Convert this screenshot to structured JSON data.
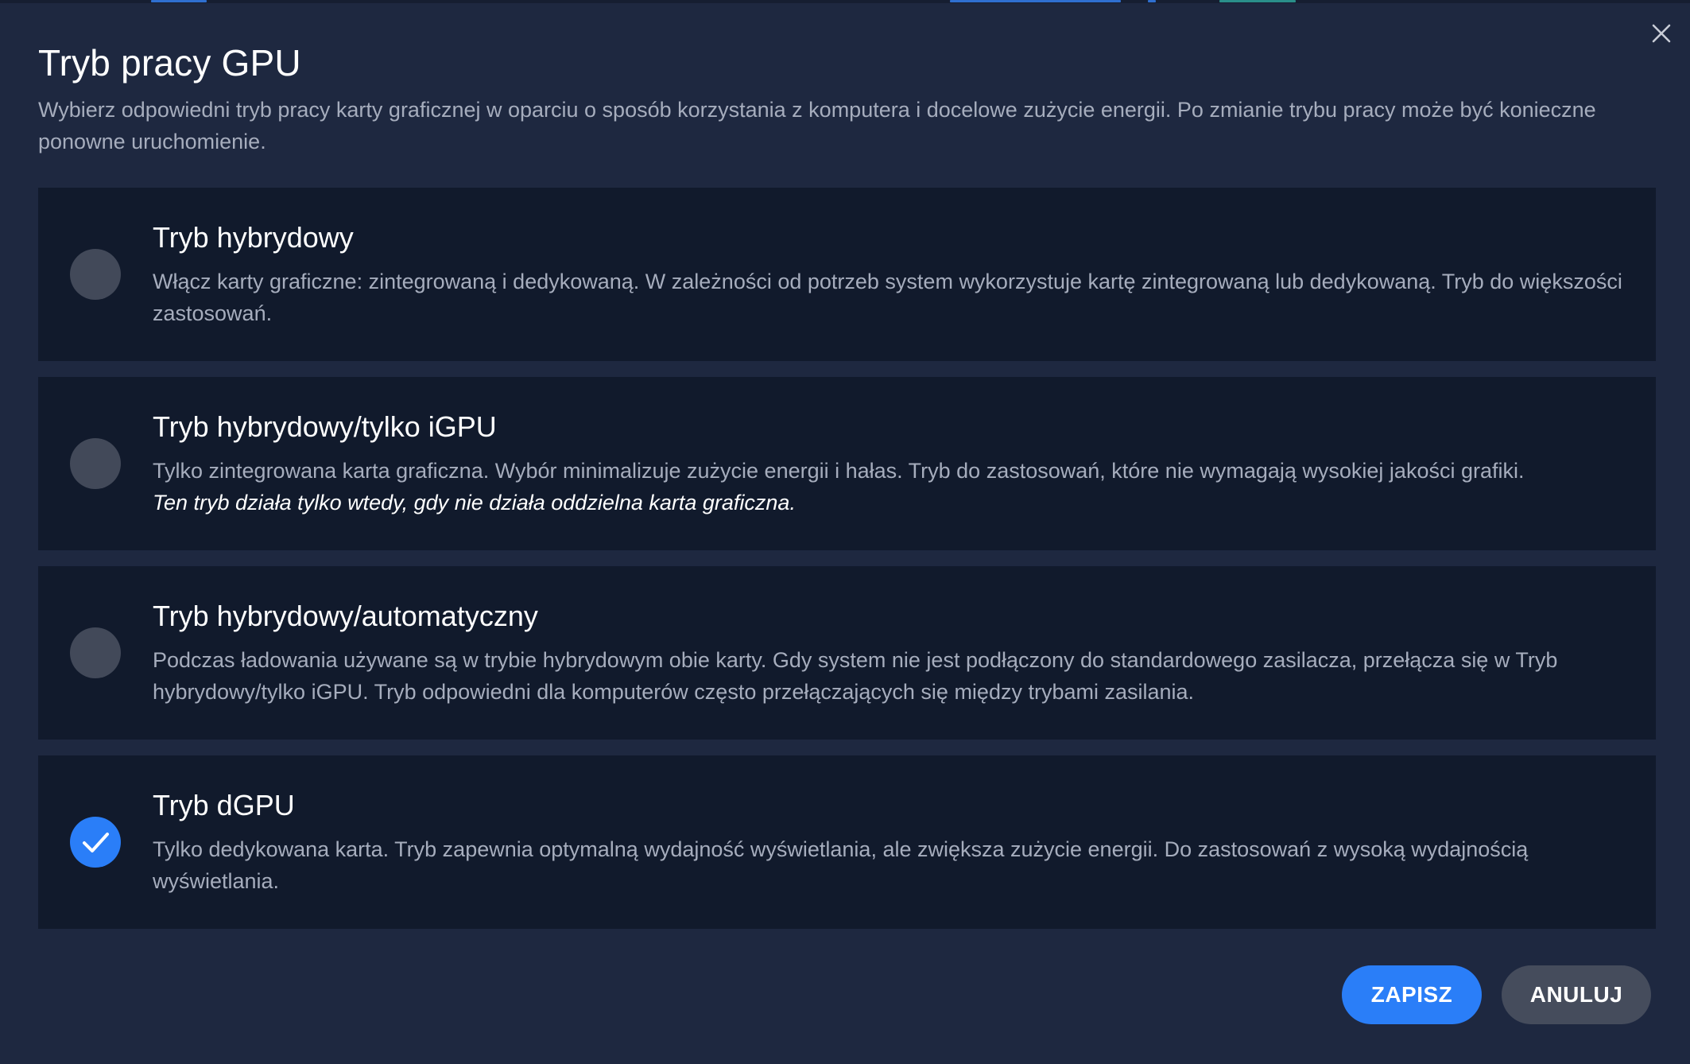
{
  "dialog": {
    "title": "Tryb pracy GPU",
    "description": "Wybierz odpowiedni tryb pracy karty graficznej w oparciu o sposób korzystania z komputera i docelowe zużycie energii. Po zmianie trybu pracy może być konieczne ponowne uruchomienie.",
    "close_icon": "close-icon"
  },
  "options": [
    {
      "title": "Tryb hybrydowy",
      "description": "Włącz karty graficzne: zintegrowaną i dedykowaną. W zależności od potrzeb system wykorzystuje kartę zintegrowaną lub dedykowaną. Tryb do większości zastosowań.",
      "selected": false
    },
    {
      "title": "Tryb hybrydowy/tylko iGPU",
      "description": "Tylko zintegrowana karta graficzna. Wybór minimalizuje zużycie energii i hałas. Tryb do zastosowań, które nie wymagają wysokiej jakości grafiki.",
      "note": "Ten tryb działa tylko wtedy, gdy nie działa oddzielna karta graficzna.",
      "selected": false
    },
    {
      "title": "Tryb hybrydowy/automatyczny",
      "description": "Podczas ładowania używane są w trybie hybrydowym obie karty. Gdy system nie jest podłączony do standardowego zasilacza, przełącza się w Tryb hybrydowy/tylko iGPU. Tryb odpowiedni dla komputerów często przełączających się między trybami zasilania.",
      "selected": false
    },
    {
      "title": "Tryb dGPU",
      "description": "Tylko dedykowana karta. Tryb zapewnia optymalną wydajność wyświetlania, ale zwiększa zużycie energii. Do zastosowań z wysoką wydajnością wyświetlania.",
      "selected": true
    }
  ],
  "buttons": {
    "save_label": "ZAPISZ",
    "cancel_label": "ANULUJ"
  },
  "colors": {
    "background": "#1e2840",
    "card": "#111a2c",
    "accent": "#2a7ef8",
    "radio_unselected": "#424959",
    "secondary_button": "#454c5c",
    "muted_text": "#a6adbd"
  }
}
